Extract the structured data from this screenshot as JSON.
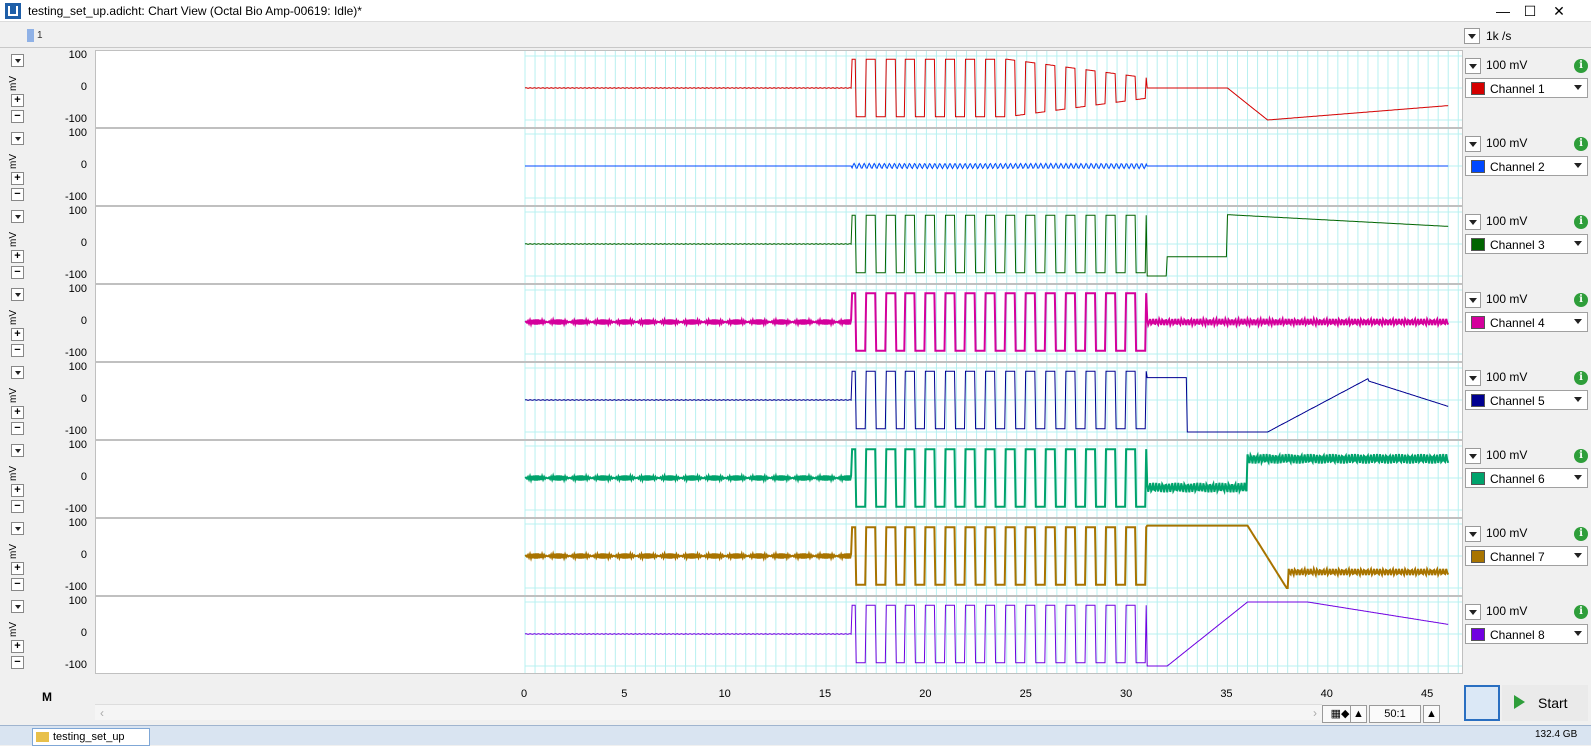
{
  "window": {
    "title": "testing_set_up.adicht: Chart View (Octal Bio Amp-00619: Idle)*",
    "minimize": "—",
    "maximize": "☐",
    "close": "✕"
  },
  "toolbar": {
    "page_label": "1",
    "sample_rate": "1k /s"
  },
  "y_ticks": [
    "100",
    "0",
    "-100"
  ],
  "y_unit": "mV",
  "channels": [
    {
      "name": "Channel 1",
      "range": "100 mV",
      "color": "#d40000"
    },
    {
      "name": "Channel 2",
      "range": "100 mV",
      "color": "#0048ff"
    },
    {
      "name": "Channel 3",
      "range": "100 mV",
      "color": "#006400"
    },
    {
      "name": "Channel 4",
      "range": "100 mV",
      "color": "#d4009c"
    },
    {
      "name": "Channel 5",
      "range": "100 mV",
      "color": "#000090"
    },
    {
      "name": "Channel 6",
      "range": "100 mV",
      "color": "#00a36c"
    },
    {
      "name": "Channel 7",
      "range": "100 mV",
      "color": "#a87400"
    },
    {
      "name": "Channel 8",
      "range": "100 mV",
      "color": "#7000e0"
    }
  ],
  "time_axis": {
    "ticks": [
      "0",
      "5",
      "10",
      "15",
      "20",
      "25",
      "30",
      "35",
      "40",
      "45"
    ]
  },
  "bottom": {
    "m_label": "M",
    "zoom_ratio": "50:1",
    "start_label": "Start"
  },
  "taskbar": {
    "item_label": "testing_set_up",
    "disk_label": "132.4 GB"
  }
}
